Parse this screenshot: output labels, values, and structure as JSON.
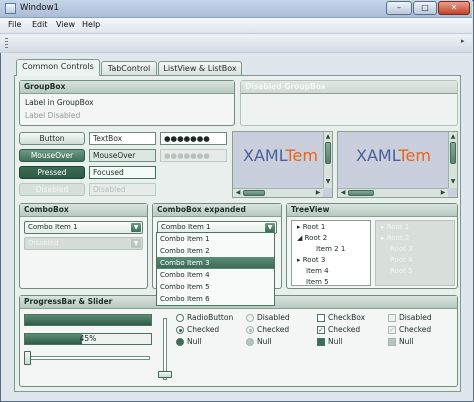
{
  "window": {
    "title": "Window1",
    "minimize": "–",
    "maximize": "□",
    "close": "✕"
  },
  "menu": [
    "File",
    "Edit",
    "View",
    "Help"
  ],
  "tabs": [
    "Common Controls",
    "TabControl",
    "ListView & ListBox"
  ],
  "groupbox": {
    "title": "GroupBox",
    "label": "Label in GroupBox",
    "label_disabled": "Label Disabled"
  },
  "disabled_groupbox": {
    "title": "Disabled GroupBox"
  },
  "buttons": {
    "button": "Button",
    "mouseover": "MouseOver",
    "pressed": "Pressed",
    "disabled": "Disabled"
  },
  "textboxes": {
    "textbox": "TextBox",
    "mouseover": "MouseOver",
    "focused": "Focused",
    "disabled": "Disabled"
  },
  "passwords": {
    "normal": "●●●●●●●",
    "disabled": "●●●●●●●"
  },
  "scrollviewer": {
    "text_a": "XAML",
    "text_b": "Tem"
  },
  "combobox": {
    "title": "ComboBox",
    "selected": "Combo Item 1",
    "disabled": "Disabled"
  },
  "combobox_expanded": {
    "title": "ComboBox expanded",
    "selected": "Combo Item 1",
    "items": [
      "Combo Item 1",
      "Combo Item 2",
      "Combo Item 3",
      "Combo Item 4",
      "Combo Item 5",
      "Combo Item 6"
    ],
    "highlighted_index": 2
  },
  "treeview": {
    "title": "TreeView",
    "items": [
      "Root 1",
      "Root 2",
      "Item 2 1",
      "Root 3",
      "Item 4",
      "Item 5"
    ],
    "disabled_items": [
      "Root 1",
      "Root 2",
      "Root 3",
      "Root 4",
      "Root 5"
    ]
  },
  "progress": {
    "title": "ProgressBar & Slider",
    "value_full": 1.0,
    "value_half": 0.45,
    "label": "45%"
  },
  "radios": {
    "radio": "RadioButton",
    "checked": "Checked",
    "null": "Null",
    "disabled": "Disabled"
  },
  "checks": {
    "checkbox": "CheckBox",
    "checked": "Checked",
    "null": "Null",
    "disabled": "Disabled"
  },
  "icons": {
    "grip": "toolbar-grip-icon",
    "tree_expander": "triangle-right-icon",
    "drop_arrow": "triangle-down-icon"
  }
}
